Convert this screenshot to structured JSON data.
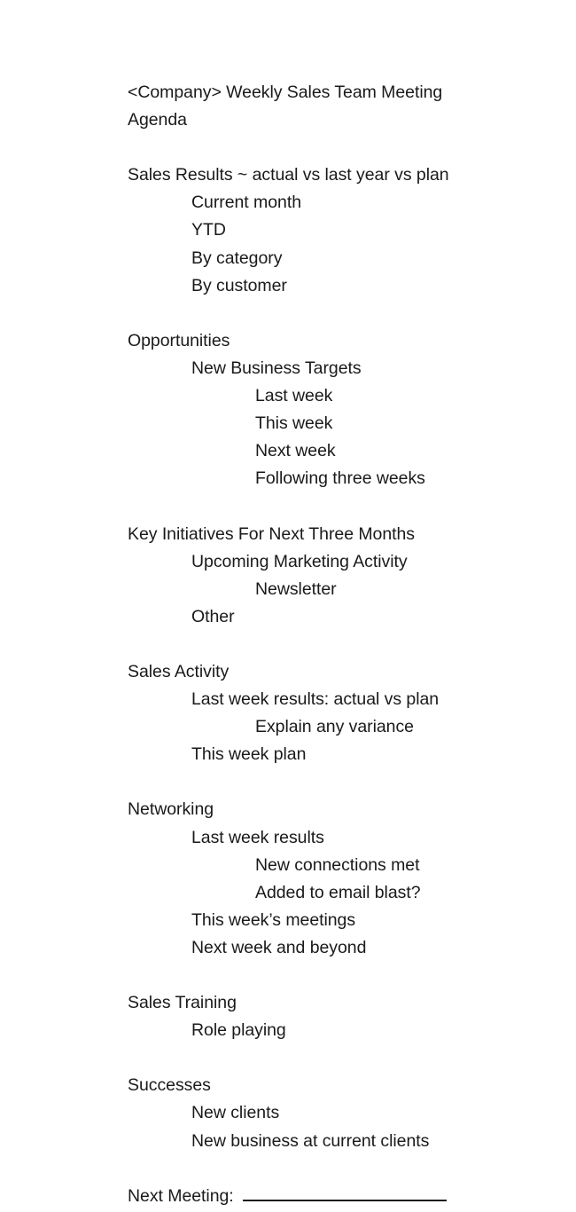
{
  "document": {
    "title_lines": [
      "<Company> Weekly Sales Team Meeting",
      "Agenda"
    ],
    "sections": [
      {
        "heading": "Sales Results ~ actual vs last year vs plan",
        "items": [
          {
            "text": "Current month",
            "level": 1
          },
          {
            "text": "YTD",
            "level": 1
          },
          {
            "text": "By category",
            "level": 1
          },
          {
            "text": "By customer",
            "level": 1
          }
        ]
      },
      {
        "heading": "Opportunities",
        "items": [
          {
            "text": "New Business Targets",
            "level": 1
          },
          {
            "text": "Last week",
            "level": 2
          },
          {
            "text": "This week",
            "level": 2
          },
          {
            "text": "Next week",
            "level": 2
          },
          {
            "text": "Following three weeks",
            "level": 2
          }
        ]
      },
      {
        "heading": "Key Initiatives For Next Three Months",
        "items": [
          {
            "text": "Upcoming Marketing Activity",
            "level": 1
          },
          {
            "text": "Newsletter",
            "level": 2
          },
          {
            "text": "Other",
            "level": 1
          }
        ]
      },
      {
        "heading": "Sales Activity",
        "items": [
          {
            "text": "Last week results: actual vs plan",
            "level": 1
          },
          {
            "text": "Explain any variance",
            "level": 2
          },
          {
            "text": "This week plan",
            "level": 1
          }
        ]
      },
      {
        "heading": "Networking",
        "items": [
          {
            "text": "Last week results",
            "level": 1
          },
          {
            "text": "New connections met",
            "level": 2
          },
          {
            "text": "Added to email blast?",
            "level": 2
          },
          {
            "text": "This week’s meetings",
            "level": 1
          },
          {
            "text": "Next week and beyond",
            "level": 1
          }
        ]
      },
      {
        "heading": "Sales Training",
        "items": [
          {
            "text": "Role playing",
            "level": 1
          }
        ]
      },
      {
        "heading": "Successes",
        "items": [
          {
            "text": "New clients",
            "level": 1
          },
          {
            "text": "New business at current clients",
            "level": 1
          }
        ]
      }
    ],
    "footer": {
      "next_meeting_label": "Next Meeting:",
      "next_meeting_value": ""
    }
  }
}
